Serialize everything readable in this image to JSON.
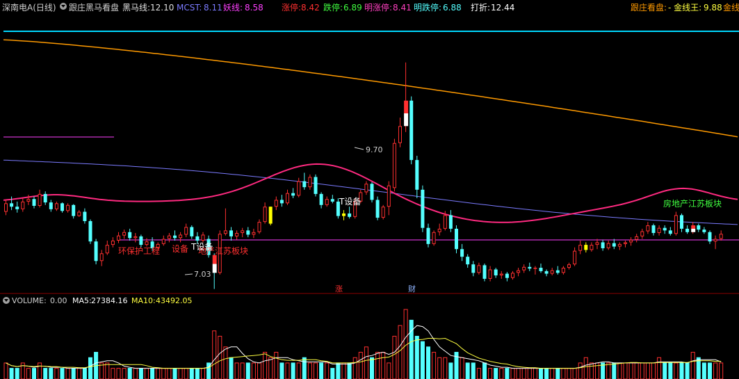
{
  "header": {
    "stock_label": "深南电A(日线)",
    "indicator_name": "跟庄黑马看盘",
    "heima_label": "黑马线:",
    "heima_value": "12.10",
    "mcst_label": "MCST:",
    "mcst_value": "8.11",
    "yao_label": "妖线:",
    "yao_value": "8.58",
    "zhangting_label": "涨停:",
    "zhangting_value": "8.42",
    "dieting_label": "跌停:",
    "dieting_value": "6.89",
    "ming_zhangting_label": "明涨停:",
    "ming_zhangting_value": "8.41",
    "ming_dieting_label": "明跌停:",
    "ming_dieting_value": "6.88",
    "dazhe_label": "打折:",
    "dazhe_value": "12.44",
    "right_label": "跟庄看盘:",
    "jinxian_label": "- 金线王:",
    "jinxian_value": "9.88",
    "cut_label": "金线"
  },
  "annotations": {
    "high_label": "9.70",
    "low_label": "7.03",
    "concept_left": "环保护工程",
    "concept_left2": "设备",
    "concept_left3": "地产江苏板块",
    "t_device_left": "T设备",
    "t_device_mid": "T设备",
    "concept_right": "房地产江苏板块",
    "marker_zhang": "涨",
    "marker_cai": "财"
  },
  "volume_header": {
    "label": "VOLUME:",
    "value": "0.00",
    "ma5_label": "MA5:",
    "ma5_value": "27384.16",
    "ma10_label": "MA10:",
    "ma10_value": "43492.05"
  },
  "colors": {
    "up": "#ff3030",
    "down": "#54ffff",
    "orange_line": "#ff9a00",
    "pink_line": "#ff2a80",
    "blue_line": "#7b7bff",
    "magenta_line": "#ff40ff",
    "cyan_line": "#00d8ff",
    "yellow_candle": "#ffff00",
    "grid_red": "#8a0000"
  },
  "chart_data": {
    "type": "candlestick",
    "title": "深南电A(日线)",
    "price_candles": [
      [
        7.94,
        8.08,
        7.9,
        8.04
      ],
      [
        8.04,
        8.12,
        7.96,
        8.0
      ],
      [
        8.0,
        8.06,
        7.93,
        7.97
      ],
      [
        7.97,
        8.1,
        7.94,
        8.06
      ],
      [
        8.06,
        8.14,
        8.02,
        8.09
      ],
      [
        8.09,
        8.12,
        7.98,
        8.01
      ],
      [
        8.01,
        8.2,
        7.99,
        8.15
      ],
      [
        8.15,
        8.18,
        8.02,
        8.05
      ],
      [
        8.05,
        8.08,
        7.94,
        7.97
      ],
      [
        7.97,
        8.06,
        7.95,
        8.04
      ],
      [
        8.04,
        8.05,
        7.93,
        7.95
      ],
      [
        7.95,
        8.04,
        7.93,
        8.02
      ],
      [
        8.02,
        8.03,
        7.86,
        7.89
      ],
      [
        7.89,
        7.96,
        7.88,
        7.94
      ],
      [
        7.94,
        7.98,
        7.8,
        7.83
      ],
      [
        7.83,
        7.85,
        7.56,
        7.59
      ],
      [
        7.59,
        7.62,
        7.32,
        7.36
      ],
      [
        7.36,
        7.49,
        7.3,
        7.45
      ],
      [
        7.45,
        7.6,
        7.43,
        7.55
      ],
      [
        7.55,
        7.64,
        7.52,
        7.6
      ],
      [
        7.6,
        7.7,
        7.57,
        7.66
      ],
      [
        7.66,
        7.73,
        7.62,
        7.7
      ],
      [
        7.7,
        7.74,
        7.6,
        7.63
      ],
      [
        7.63,
        7.69,
        7.58,
        7.65
      ],
      [
        7.65,
        7.67,
        7.52,
        7.55
      ],
      [
        7.55,
        7.63,
        7.53,
        7.59
      ],
      [
        7.59,
        7.64,
        7.48,
        7.51
      ],
      [
        7.51,
        7.58,
        7.49,
        7.56
      ],
      [
        7.56,
        7.66,
        7.54,
        7.62
      ],
      [
        7.62,
        7.69,
        7.58,
        7.66
      ],
      [
        7.66,
        7.72,
        7.6,
        7.63
      ],
      [
        7.63,
        7.7,
        7.58,
        7.67
      ],
      [
        7.67,
        7.8,
        7.64,
        7.76
      ],
      [
        7.76,
        7.78,
        7.62,
        7.65
      ],
      [
        7.65,
        7.7,
        7.56,
        7.6
      ],
      [
        7.6,
        7.7,
        7.58,
        7.67
      ],
      [
        7.62,
        7.66,
        7.4,
        7.43
      ],
      [
        7.43,
        7.45,
        7.03,
        7.22
      ],
      [
        7.22,
        7.72,
        7.2,
        7.68
      ],
      [
        7.68,
        7.98,
        7.66,
        7.72
      ],
      [
        7.72,
        7.76,
        7.6,
        7.65
      ],
      [
        7.65,
        7.72,
        7.61,
        7.69
      ],
      [
        7.69,
        7.75,
        7.64,
        7.72
      ],
      [
        7.72,
        7.76,
        7.64,
        7.67
      ],
      [
        7.67,
        7.74,
        7.63,
        7.7
      ],
      [
        7.7,
        7.85,
        7.68,
        7.82
      ],
      [
        7.82,
        8.05,
        7.8,
        8.0
      ],
      [
        7.8,
        8.0,
        7.78,
        8.0
      ],
      [
        8.0,
        8.12,
        7.96,
        8.08
      ],
      [
        8.08,
        8.14,
        8.0,
        8.04
      ],
      [
        8.04,
        8.2,
        8.02,
        8.16
      ],
      [
        8.16,
        8.22,
        8.1,
        8.13
      ],
      [
        8.13,
        8.34,
        8.11,
        8.3
      ],
      [
        8.3,
        8.4,
        8.2,
        8.23
      ],
      [
        8.23,
        8.38,
        8.2,
        8.35
      ],
      [
        8.35,
        8.38,
        8.12,
        8.15
      ],
      [
        8.15,
        8.17,
        7.98,
        8.02
      ],
      [
        8.02,
        8.12,
        8.0,
        8.09
      ],
      [
        8.09,
        8.14,
        8.04,
        8.06
      ],
      [
        8.06,
        8.1,
        7.86,
        7.89
      ],
      [
        7.89,
        7.96,
        7.84,
        7.92
      ],
      [
        7.92,
        8.0,
        7.86,
        7.88
      ],
      [
        7.88,
        8.1,
        7.86,
        8.06
      ],
      [
        8.06,
        8.2,
        8.04,
        8.17
      ],
      [
        8.17,
        8.3,
        8.14,
        8.27
      ],
      [
        8.27,
        8.29,
        8.05,
        8.08
      ],
      [
        8.08,
        8.12,
        7.84,
        7.87
      ],
      [
        7.87,
        8.02,
        7.85,
        8.0
      ],
      [
        8.0,
        8.3,
        7.9,
        8.25
      ],
      [
        8.22,
        8.8,
        8.18,
        8.75
      ],
      [
        8.75,
        9.05,
        8.7,
        8.95
      ],
      [
        8.95,
        9.7,
        8.88,
        9.25
      ],
      [
        9.25,
        9.3,
        8.5,
        8.55
      ],
      [
        8.55,
        8.6,
        8.1,
        8.2
      ],
      [
        8.2,
        8.25,
        7.7,
        7.75
      ],
      [
        7.75,
        7.8,
        7.52,
        7.56
      ],
      [
        7.56,
        7.72,
        7.54,
        7.7
      ],
      [
        7.7,
        7.8,
        7.66,
        7.74
      ],
      [
        7.74,
        7.95,
        7.72,
        7.9
      ],
      [
        7.9,
        7.96,
        7.7,
        7.74
      ],
      [
        7.74,
        7.78,
        7.45,
        7.5
      ],
      [
        7.5,
        7.56,
        7.36,
        7.41
      ],
      [
        7.41,
        7.44,
        7.28,
        7.32
      ],
      [
        7.32,
        7.36,
        7.18,
        7.22
      ],
      [
        7.22,
        7.34,
        7.2,
        7.31
      ],
      [
        7.31,
        7.33,
        7.12,
        7.15
      ],
      [
        7.15,
        7.3,
        7.12,
        7.26
      ],
      [
        7.26,
        7.28,
        7.16,
        7.19
      ],
      [
        7.19,
        7.24,
        7.15,
        7.21
      ],
      [
        7.21,
        7.23,
        7.12,
        7.16
      ],
      [
        7.16,
        7.24,
        7.14,
        7.22
      ],
      [
        7.22,
        7.28,
        7.18,
        7.25
      ],
      [
        7.25,
        7.32,
        7.22,
        7.29
      ],
      [
        7.29,
        7.34,
        7.24,
        7.27
      ],
      [
        7.27,
        7.3,
        7.2,
        7.28
      ],
      [
        7.28,
        7.33,
        7.22,
        7.24
      ],
      [
        7.24,
        7.26,
        7.18,
        7.21
      ],
      [
        7.21,
        7.28,
        7.19,
        7.25
      ],
      [
        7.25,
        7.3,
        7.2,
        7.22
      ],
      [
        7.22,
        7.3,
        7.2,
        7.28
      ],
      [
        7.28,
        7.34,
        7.26,
        7.32
      ],
      [
        7.32,
        7.52,
        7.3,
        7.48
      ],
      [
        7.48,
        7.6,
        7.44,
        7.55
      ],
      [
        7.55,
        7.58,
        7.46,
        7.49
      ],
      [
        7.49,
        7.58,
        7.47,
        7.55
      ],
      [
        7.55,
        7.62,
        7.5,
        7.58
      ],
      [
        7.58,
        7.61,
        7.48,
        7.51
      ],
      [
        7.51,
        7.6,
        7.49,
        7.57
      ],
      [
        7.57,
        7.62,
        7.5,
        7.53
      ],
      [
        7.53,
        7.58,
        7.49,
        7.56
      ],
      [
        7.56,
        7.6,
        7.52,
        7.58
      ],
      [
        7.58,
        7.64,
        7.54,
        7.61
      ],
      [
        7.61,
        7.68,
        7.58,
        7.65
      ],
      [
        7.65,
        7.74,
        7.62,
        7.71
      ],
      [
        7.71,
        7.82,
        7.68,
        7.78
      ],
      [
        7.78,
        7.8,
        7.66,
        7.69
      ],
      [
        7.69,
        7.78,
        7.66,
        7.75
      ],
      [
        7.75,
        7.78,
        7.68,
        7.72
      ],
      [
        7.72,
        7.76,
        7.66,
        7.68
      ],
      [
        7.68,
        7.94,
        7.66,
        7.9
      ],
      [
        7.9,
        7.92,
        7.7,
        7.74
      ],
      [
        7.74,
        7.78,
        7.68,
        7.7
      ],
      [
        7.7,
        7.82,
        7.68,
        7.78
      ],
      [
        7.78,
        7.8,
        7.7,
        7.73
      ],
      [
        7.73,
        7.76,
        7.68,
        7.7
      ],
      [
        7.7,
        7.72,
        7.56,
        7.59
      ],
      [
        7.59,
        7.66,
        7.5,
        7.62
      ],
      [
        7.62,
        7.72,
        7.6,
        7.68
      ]
    ],
    "yellow_candle_indices": [
      47,
      60,
      103
    ],
    "white_candle_indices": [
      37,
      71
    ],
    "white_candle_indices_extra": [
      122
    ],
    "volume": [
      3,
      2,
      2,
      3,
      2,
      2,
      3,
      2,
      2,
      2,
      2,
      2,
      2,
      2,
      2,
      4,
      5,
      3,
      3,
      2,
      2,
      2,
      2,
      2,
      2,
      2,
      2,
      2,
      2,
      2,
      2,
      2,
      2,
      2,
      2,
      2,
      3,
      9,
      8,
      6,
      4,
      3,
      3,
      3,
      3,
      3,
      5,
      4,
      5,
      3,
      3,
      3,
      3,
      4,
      3,
      3,
      3,
      3,
      2,
      3,
      3,
      3,
      4,
      5,
      6,
      4,
      5,
      5,
      3,
      8,
      10,
      13,
      11,
      8,
      7,
      6,
      5,
      4,
      4,
      3,
      5,
      4,
      3,
      3,
      2,
      3,
      2,
      2,
      2,
      2,
      2,
      2,
      2,
      2,
      2,
      2,
      2,
      2,
      2,
      2,
      2,
      2,
      3,
      4,
      3,
      3,
      3,
      3,
      3,
      3,
      3,
      3,
      3,
      3,
      3,
      3,
      4,
      3,
      3,
      3,
      3,
      3,
      5,
      4,
      3,
      3,
      3,
      3,
      3,
      3
    ],
    "volume_red_indices": [
      37,
      38,
      46,
      48,
      52,
      55,
      63,
      64,
      66,
      68,
      69,
      70,
      71,
      81,
      93,
      102,
      103,
      113,
      115,
      122
    ]
  }
}
